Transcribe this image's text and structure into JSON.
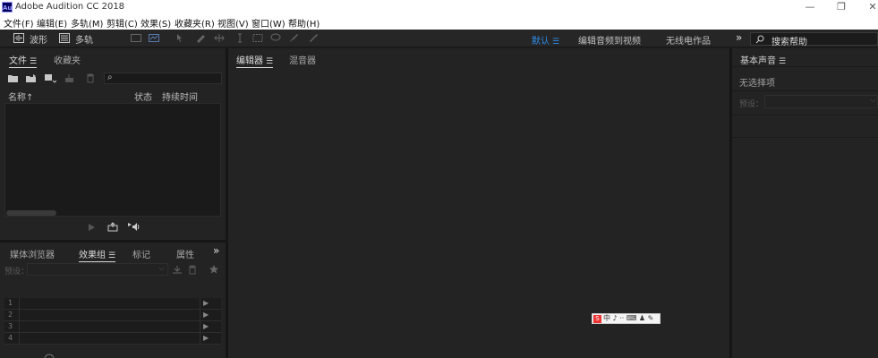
{
  "window": {
    "app_icon_text": "Au",
    "title": "Adobe Audition CC 2018",
    "minimize": "—",
    "restore": "❐",
    "close": "✕"
  },
  "menu": [
    "文件(F)",
    "编辑(E)",
    "多轨(M)",
    "剪辑(C)",
    "效果(S)",
    "收藏夹(R)",
    "视图(V)",
    "窗口(W)",
    "帮助(H)"
  ],
  "toolbar": {
    "waveform_label": "波形",
    "multitrack_label": "多轨"
  },
  "workspaces": {
    "default": "默认",
    "edit_audio_to_video": "编辑音频到视频",
    "radio_production": "无线电作品",
    "more": "»"
  },
  "search": {
    "placeholder": "搜索帮助"
  },
  "files_panel": {
    "tabs": [
      "文件",
      "收藏夹"
    ],
    "search_glyph": "⌕",
    "columns": {
      "name": "名称",
      "name_sort": "↑",
      "status": "状态",
      "duration": "持续时间"
    }
  },
  "effects_panel": {
    "tabs": [
      "媒体浏览器",
      "效果组",
      "标记",
      "属性"
    ],
    "more": "»",
    "preset_label": "预设：",
    "rows": [
      "1",
      "2",
      "3",
      "4"
    ],
    "row_arrow": "▶"
  },
  "editor_panel": {
    "tabs": [
      "编辑器",
      "混音器"
    ]
  },
  "essential_sound": {
    "tab": "基本声音",
    "no_selection": "无选择项",
    "preset_label": "预设："
  },
  "ime_bar": {
    "logo": "S",
    "text": "中 ♪ ·· ⌨ ♟ ✎"
  },
  "colors": {
    "accent": "#2d8ceb",
    "panel_bg": "#232323",
    "app_bg": "#1d1d1d"
  }
}
